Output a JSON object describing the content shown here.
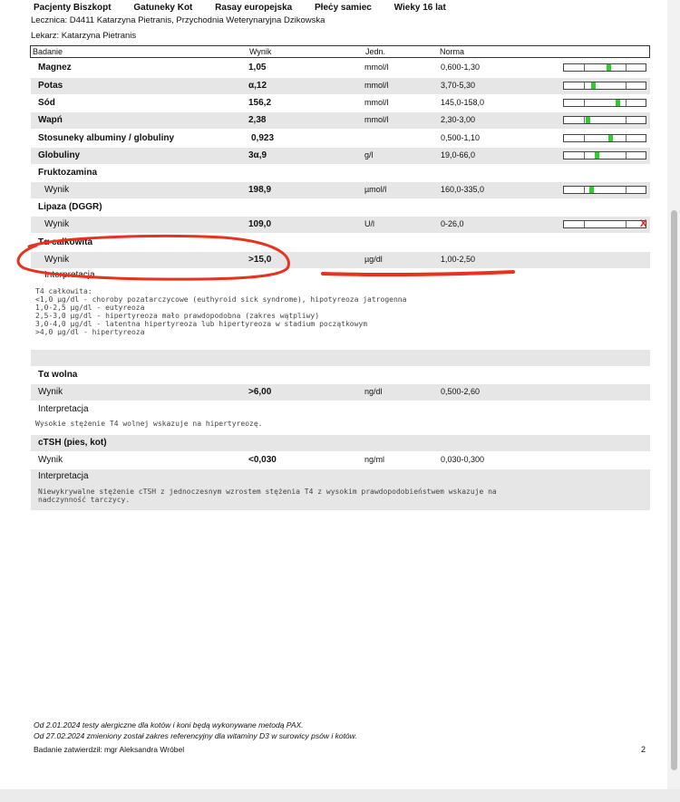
{
  "header": {
    "patient": "Pacjenty Biszkopt",
    "species": "Gatuneky Kot",
    "breed": "Rasay europejska",
    "sex": "Płeċy samiec",
    "age": "Wieky 16 lat",
    "clinic": "Lecznica:  D4411  Katarzyna  Pietranis,  Przychodnia  Weterynaryjna  Dzikowska",
    "doctor": "Lekarz: Katarzyna Pietranis"
  },
  "table_header": {
    "test": "Badanie",
    "result": "Wynik",
    "unit": "Jedn.",
    "norm": "Norma"
  },
  "rows": [
    {
      "name": "Magnez",
      "value": "1,05",
      "unit": "mmol/l",
      "norm": "0,600-1,30",
      "marker_fraction": 0.55
    },
    {
      "name": "Potas",
      "value": "α,12",
      "unit": "mmol/l",
      "norm": "3,70-5,30",
      "marker_fraction": 0.35
    },
    {
      "name": "Sód",
      "value": "156,2",
      "unit": "mmol/l",
      "norm": "145,0-158,0",
      "marker_fraction": 0.67
    },
    {
      "name": "Wapń",
      "value": "2,38",
      "unit": "mmol/l",
      "norm": "2,30-3,00",
      "marker_fraction": 0.28
    },
    {
      "name": "Stosunekγ albuminy / globuliny",
      "value": "0,923",
      "unit": "",
      "norm": "0,500-1,10",
      "marker_fraction": 0.58
    },
    {
      "name": "Globuliny",
      "value": "3α,9",
      "unit": "g/l",
      "norm": "19,0-66,0",
      "marker_fraction": 0.4
    }
  ],
  "fructosamine": {
    "name": "Fruktozamina",
    "label": "Wynik",
    "value": "198,9",
    "unit": "µmol/l",
    "norm": "160,0-335,0",
    "marker_fraction": 0.33
  },
  "lipase": {
    "name": "Lipaza (DGGR)",
    "label": "Wynik",
    "value": "109,0",
    "unit": "U/l",
    "norm": "0-26,0",
    "marker_symbol": "X"
  },
  "t4_total": {
    "name": "Tα całkowita",
    "label": "Wynik",
    "value": ">15,0",
    "unit": "µg/dl",
    "norm": "1,00-2,50",
    "interp_label": "Interpretacja",
    "interp_lines": [
      "T4 całkowita:",
      "<1,0 µg/dl - choroby pozatarczycowe (euthyroid sick syndrome), hipotyreoza jatrogenna",
      "1,0-2,5 µg/dl - eutyreoza",
      "2,5-3,0 µg/dl - hipertyreoza mało prawdopodobna (zakres wątpliwy)",
      "3,0-4,0 µg/dl - latentna hipertyreoza lub hipertyreoza w stadium początkowym",
      ">4,0 µg/dl - hipertyreoza"
    ]
  },
  "t4_free": {
    "name": "Tα wolna",
    "label": "Wynik",
    "value": ">6,00",
    "unit": "ng/dl",
    "norm": "0,500-2,60",
    "interp_label": "Interpretacja",
    "interp_text": "Wysokie stężenie T4 wolnej wskazuje na hipertyreozę."
  },
  "ctsh": {
    "name": "cTSH (pies, kot)",
    "label": "Wynik",
    "value": "<0,030",
    "unit": "ng/ml",
    "norm": "0,030-0,300",
    "interp_label": "Interpretacja",
    "interp_line1": "Niewykrywalne stężenie cTSH z jednoczesnym wzrostem stężenia T4 z wysokim prawdopodobieństwem wskazuje na",
    "interp_line2": "nadczynność tarczycy."
  },
  "footer": {
    "note1": "Od 2.01.2024 testy alergiczne dla kotów i koni będą wykonywane metodą PAX.",
    "note2": "Od 27.02.2024 zmieniony został zakres referencyjny dla witaminy D3 w surowicy psów i kotów.",
    "approved": "Badanie zatwierdził: mgr Aleksandra Wróbel",
    "page": "2"
  },
  "colors": {
    "shade": "#e6e6e6",
    "marker": "#2bd12b",
    "annotation": "#e8321e"
  }
}
